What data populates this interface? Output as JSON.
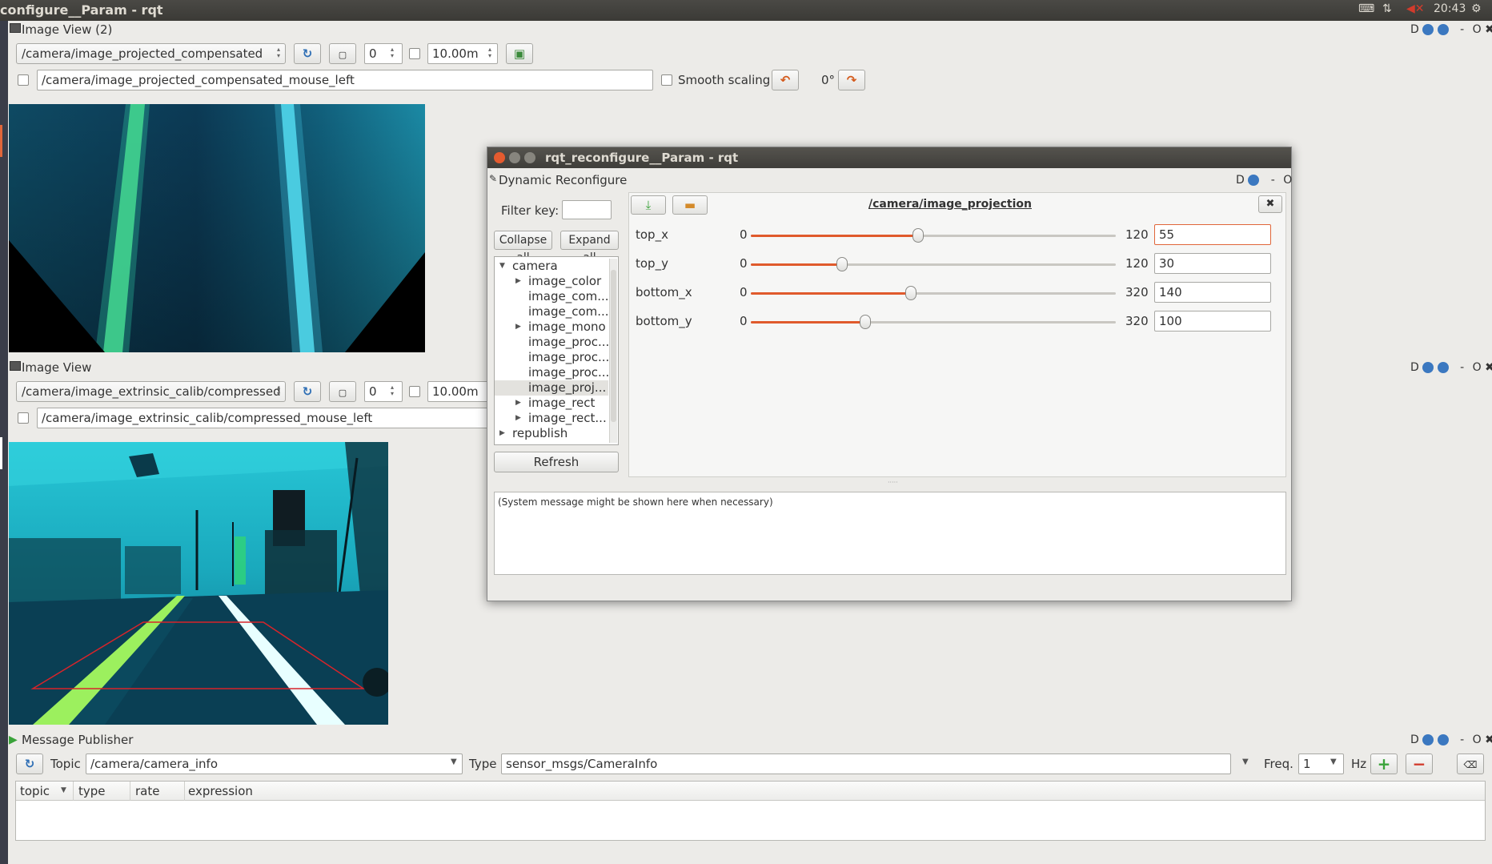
{
  "topbar": {
    "title": "configure__Param - rqt",
    "time": "20:43"
  },
  "view2": {
    "title": "Image View (2)",
    "topic": "/camera/image_projected_compensated",
    "spin_value": "0",
    "duration": "10.00m",
    "mouse_topic": "/camera/image_projected_compensated_mouse_left",
    "smooth_scaling": "Smooth scaling",
    "rotation": "0°"
  },
  "view1": {
    "title": "Image View",
    "topic": "/camera/image_extrinsic_calib/compressed",
    "spin_value": "0",
    "duration": "10.00m",
    "mouse_topic": "/camera/image_extrinsic_calib/compressed_mouse_left"
  },
  "dock_controls": {
    "d": "D",
    "minus": "-",
    "o": "O"
  },
  "dialog": {
    "title": "rqt_reconfigure__Param - rqt",
    "plugin_title": "Dynamic Reconfigure",
    "filter_label": "Filter key:",
    "filter_value": "",
    "collapse_all": "Collapse all",
    "expand_all": "Expand all",
    "refresh": "Refresh",
    "node_name": "/camera/image_projection",
    "system_message": "(System message might be shown here when necessary)",
    "tree": [
      {
        "label": "camera",
        "level": 0,
        "arrow": "down"
      },
      {
        "label": "image_color",
        "level": 1,
        "arrow": "right"
      },
      {
        "label": "image_com...",
        "level": 1,
        "arrow": ""
      },
      {
        "label": "image_com...",
        "level": 1,
        "arrow": ""
      },
      {
        "label": "image_mono",
        "level": 1,
        "arrow": "right"
      },
      {
        "label": "image_proc...",
        "level": 1,
        "arrow": ""
      },
      {
        "label": "image_proc...",
        "level": 1,
        "arrow": ""
      },
      {
        "label": "image_proc...",
        "level": 1,
        "arrow": ""
      },
      {
        "label": "image_proj...",
        "level": 1,
        "arrow": "",
        "selected": true
      },
      {
        "label": "image_rect",
        "level": 1,
        "arrow": "right"
      },
      {
        "label": "image_rect...",
        "level": 1,
        "arrow": "right"
      },
      {
        "label": "republish",
        "level": 0,
        "arrow": "right"
      }
    ],
    "params": [
      {
        "name": "top_x",
        "min": "0",
        "max": "120",
        "value": "55",
        "fraction": 0.458
      },
      {
        "name": "top_y",
        "min": "0",
        "max": "120",
        "value": "30",
        "fraction": 0.25
      },
      {
        "name": "bottom_x",
        "min": "0",
        "max": "320",
        "value": "140",
        "fraction": 0.4375
      },
      {
        "name": "bottom_y",
        "min": "0",
        "max": "320",
        "value": "100",
        "fraction": 0.3125
      }
    ]
  },
  "publisher": {
    "title": "Message Publisher",
    "topic_label": "Topic",
    "topic_value": "/camera/camera_info",
    "type_label": "Type",
    "type_value": "sensor_msgs/CameraInfo",
    "freq_label": "Freq.",
    "freq_value": "1",
    "hz_label": "Hz",
    "columns": [
      "topic",
      "type",
      "rate",
      "expression"
    ]
  },
  "colors": {
    "accent_orange": "#e05a2c",
    "title_bar": "#3b3a36",
    "camera_cyan": "#1fb7c8"
  }
}
